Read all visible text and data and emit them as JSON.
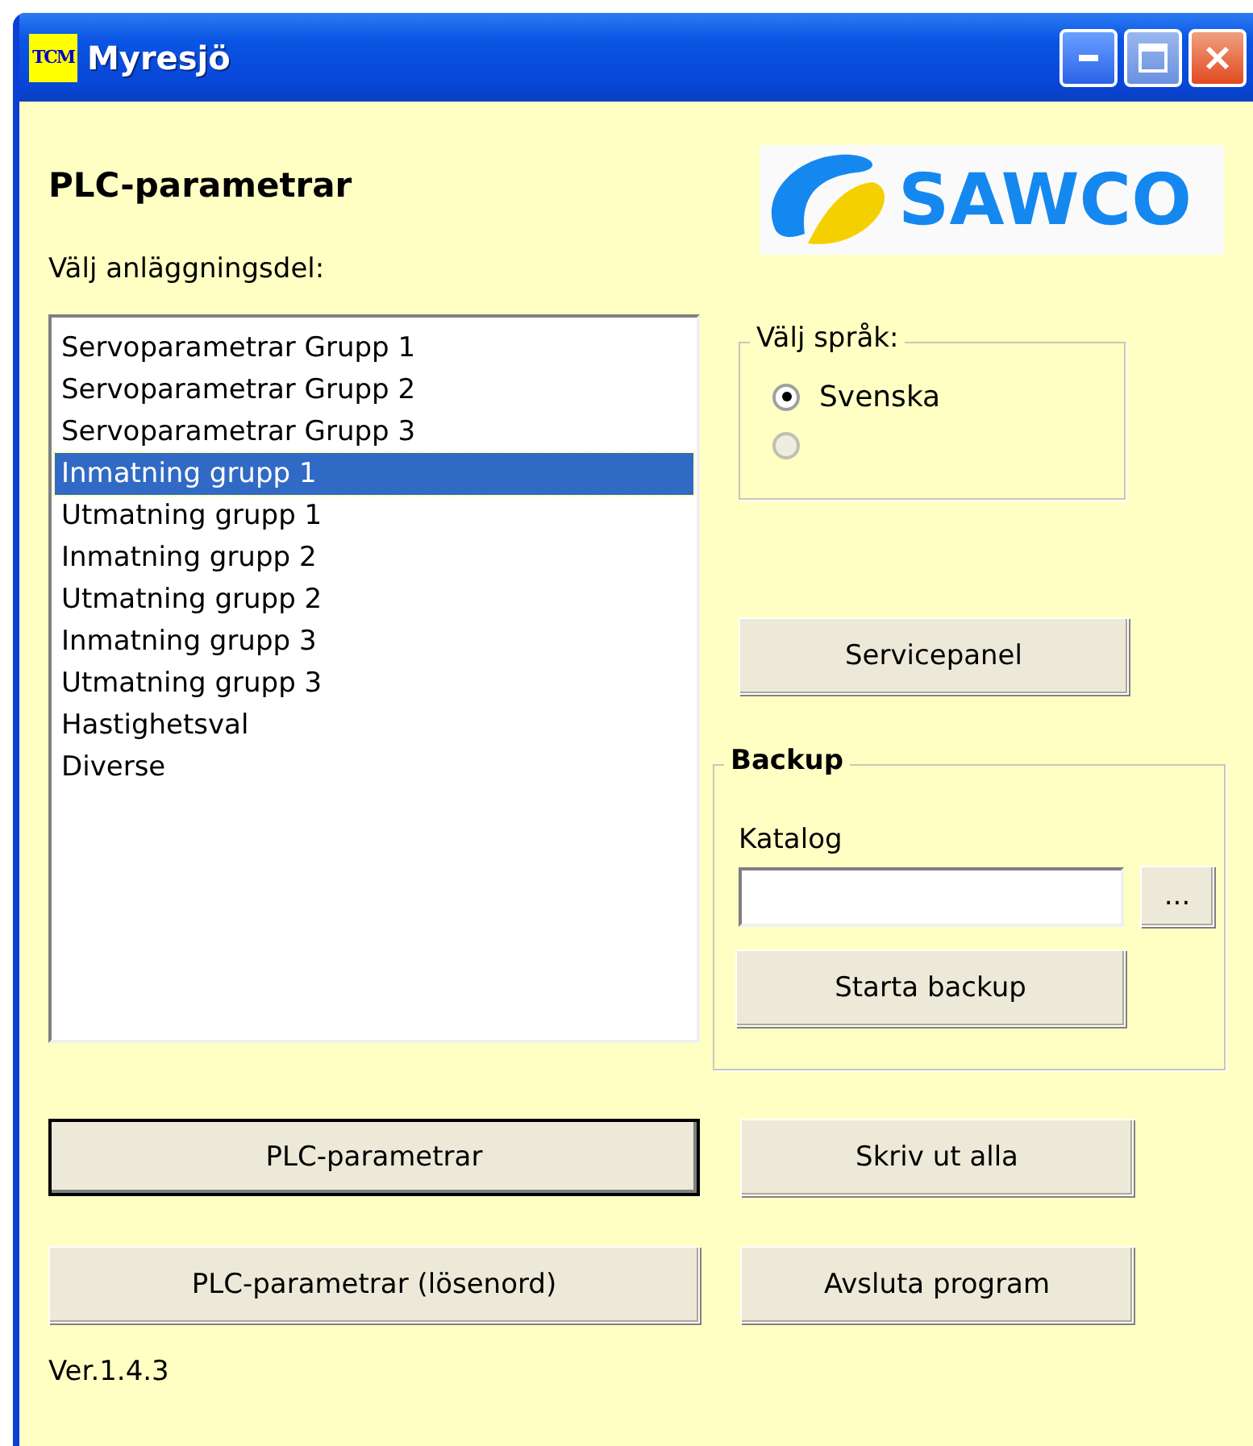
{
  "window": {
    "icon_text": "TCM",
    "title": "Myresjö"
  },
  "heading": "PLC-parametrar",
  "logo": {
    "text": "SAWCO"
  },
  "list_label": "Välj anläggningsdel:",
  "list_items": [
    {
      "label": "Servoparametrar Grupp 1",
      "selected": false
    },
    {
      "label": "Servoparametrar Grupp 2",
      "selected": false
    },
    {
      "label": "Servoparametrar Grupp 3",
      "selected": false
    },
    {
      "label": "Inmatning grupp 1",
      "selected": true
    },
    {
      "label": "Utmatning grupp 1",
      "selected": false
    },
    {
      "label": "Inmatning grupp 2",
      "selected": false
    },
    {
      "label": "Utmatning grupp 2",
      "selected": false
    },
    {
      "label": "Inmatning grupp 3",
      "selected": false
    },
    {
      "label": "Utmatning grupp 3",
      "selected": false
    },
    {
      "label": "Hastighetsval",
      "selected": false
    },
    {
      "label": "Diverse",
      "selected": false
    }
  ],
  "language": {
    "title": "Välj språk:",
    "options": [
      {
        "label": "Svenska",
        "selected": true,
        "disabled": false
      },
      {
        "selected": false,
        "disabled": true
      }
    ]
  },
  "service_button": "Servicepanel",
  "backup": {
    "title": "Backup",
    "field_label": "Katalog",
    "browse_button": "...",
    "start_button": "Starta backup"
  },
  "bottom_buttons": [
    {
      "label": "PLC-parametrar",
      "default": true
    },
    {
      "label": "Skriv ut alla",
      "default": false
    },
    {
      "label": "PLC-parametrar (lösenord)",
      "default": false
    },
    {
      "label": "Avsluta program",
      "default": false
    }
  ],
  "version": "Ver.1.4.3"
}
